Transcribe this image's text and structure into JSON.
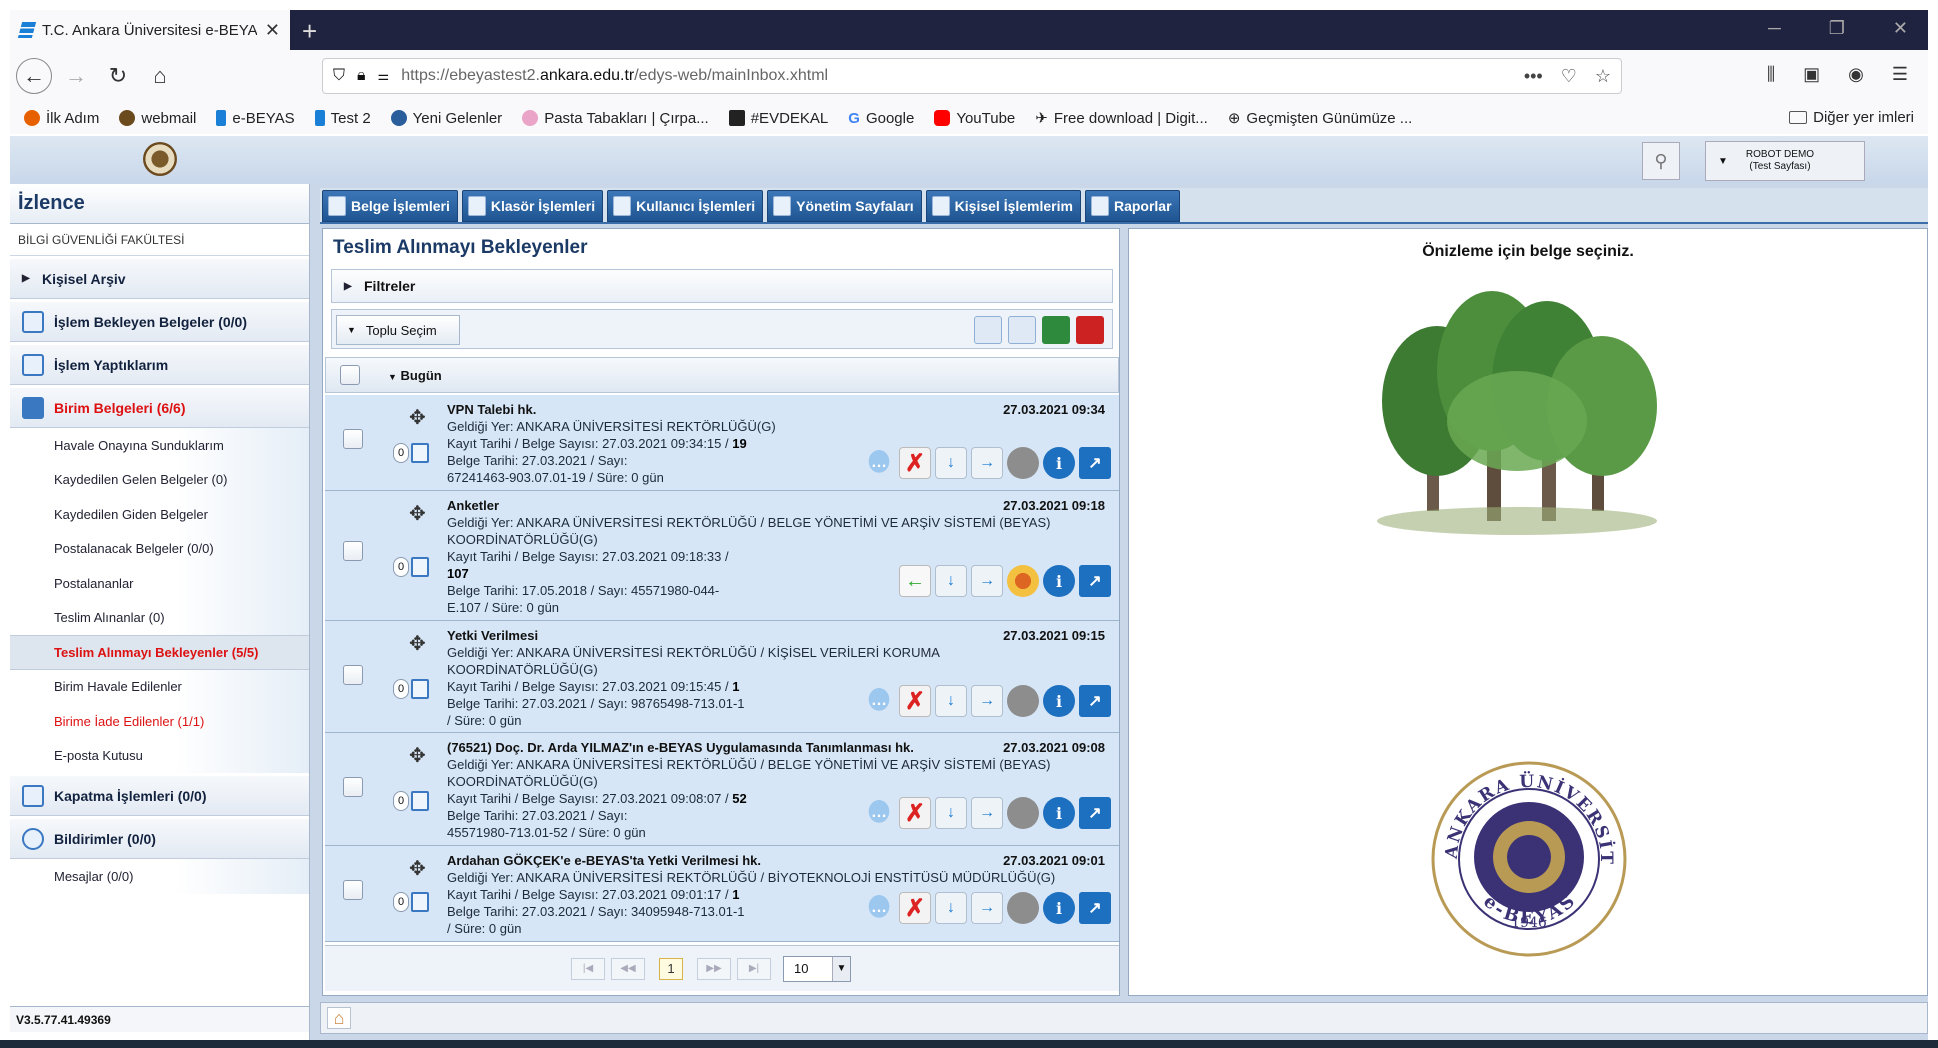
{
  "browser": {
    "tab_title": "T.C. Ankara Üniversitesi e-BEYA",
    "url_prefix": "https://ebeyastest2.",
    "url_host": "ankara.edu.tr",
    "url_path": "/edys-web/mainInbox.xhtml",
    "bookmarks": [
      "İlk Adım",
      "webmail",
      "e-BEYAS",
      "Test 2",
      "Yeni Gelenler",
      "Pasta Tabakları | Çırpa...",
      "#EVDEKAL",
      "Google",
      "YouTube",
      "Free download | Digit...",
      "Geçmişten Günümüze ..."
    ],
    "other_bookmarks": "Diğer yer imleri"
  },
  "header": {
    "user_name": "ROBOT DEMO",
    "user_sub": "(Test Sayfası)"
  },
  "sidebar": {
    "title": "İzlence",
    "unit": "BİLGİ GÜVENLİĞİ FAKÜLTESİ",
    "arsiv": "Kişisel Arşiv",
    "bekleyen": "İşlem Bekleyen Belgeler (0/0)",
    "yaptiklarim": "İşlem Yaptıklarım",
    "birim": "Birim Belgeleri (6/6)",
    "subitems": [
      "Havale Onayına Sunduklarım",
      "Kaydedilen Gelen Belgeler (0)",
      "Kaydedilen Giden Belgeler",
      "Postalanacak Belgeler (0/0)",
      "Postalananlar",
      "Teslim Alınanlar (0)",
      "Teslim Alınmayı Bekleyenler (5/5)",
      "Birim Havale Edilenler",
      "Birime İade Edilenler (1/1)",
      "E-posta Kutusu"
    ],
    "kapatma": "Kapatma İşlemleri (0/0)",
    "bildirimler": "Bildirimler (0/0)",
    "mesajlar": "Mesajlar (0/0)",
    "version": "V3.5.77.41.49369"
  },
  "menu": [
    "Belge İşlemleri",
    "Klasör İşlemleri",
    "Kullanıcı İşlemleri",
    "Yönetim Sayfaları",
    "Kişisel İşlemlerim",
    "Raporlar"
  ],
  "list": {
    "title": "Teslim Alınmayı Bekleyenler",
    "filters": "Filtreler",
    "bulk": "Toplu Seçim",
    "group": "Bugün",
    "rows": [
      {
        "count": "0",
        "title": "VPN Talebi hk.",
        "date": "27.03.2021 09:34",
        "l1": "Geldiği Yer: ANKARA ÜNİVERSİTESİ REKTÖRLÜĞÜ(G)",
        "l2": "Kayıt Tarihi / Belge Sayısı: 27.03.2021 09:34:15 / ",
        "l2b": "19",
        "l3": "Belge Tarihi: 27.03.2021 / Sayı:",
        "l4": "67241463-903.07.01-19 / Süre: 0 gün"
      },
      {
        "count": "0",
        "title": "Anketler",
        "date": "27.03.2021 09:18",
        "l1": "Geldiği Yer: ANKARA ÜNİVERSİTESİ REKTÖRLÜĞÜ / BELGE YÖNETİMİ VE ARŞİV SİSTEMİ (BEYAS) KOORDİNATÖRLÜĞÜ(G)",
        "l2": "Kayıt Tarihi / Belge Sayısı: 27.03.2021 09:18:33 / ",
        "l2b": "107",
        "l3": "Belge Tarihi: 17.05.2018 / Sayı: 45571980-044-",
        "l4": "E.107 / Süre: 0 gün"
      },
      {
        "count": "0",
        "title": "Yetki Verilmesi",
        "date": "27.03.2021 09:15",
        "l1": "Geldiği Yer: ANKARA ÜNİVERSİTESİ REKTÖRLÜĞÜ / KİŞİSEL VERİLERİ KORUMA KOORDİNATÖRLÜĞÜ(G)",
        "l2": "Kayıt Tarihi / Belge Sayısı: 27.03.2021 09:15:45 / ",
        "l2b": "1",
        "l3": "Belge Tarihi: 27.03.2021 / Sayı: 98765498-713.01-1",
        "l4": "/ Süre: 0 gün"
      },
      {
        "count": "0",
        "title": "(76521) Doç. Dr. Arda YILMAZ'ın e-BEYAS Uygulamasında Tanımlanması hk.",
        "date": "27.03.2021 09:08",
        "l1": "Geldiği Yer: ANKARA ÜNİVERSİTESİ REKTÖRLÜĞÜ / BELGE YÖNETİMİ VE ARŞİV SİSTEMİ (BEYAS) KOORDİNATÖRLÜĞÜ(G)",
        "l2": "Kayıt Tarihi / Belge Sayısı: 27.03.2021 09:08:07 / ",
        "l2b": "52",
        "l3": "Belge Tarihi: 27.03.2021 / Sayı:",
        "l4": "45571980-713.01-52 / Süre: 0 gün"
      },
      {
        "count": "0",
        "title": "Ardahan GÖKÇEK'e e-BEYAS'ta Yetki Verilmesi hk.",
        "date": "27.03.2021 09:01",
        "l1": "Geldiği Yer: ANKARA ÜNİVERSİTESİ REKTÖRLÜĞÜ / BİYOTEKNOLOJİ ENSTİTÜSÜ MÜDÜRLÜĞÜ(G)",
        "l2": "Kayıt Tarihi / Belge Sayısı: 27.03.2021 09:01:17 / ",
        "l2b": "1",
        "l3": "Belge Tarihi: 27.03.2021 / Sayı: 34095948-713.01-1",
        "l4": "/ Süre: 0 gün"
      }
    ],
    "page_current": "1",
    "page_size": "10"
  },
  "preview": {
    "message": "Önizleme için belge seçiniz.",
    "seal_top": "ANKARA ÜNİVERSİTESİ",
    "seal_year": "1946",
    "seal_bottom": "e-BEYAS"
  }
}
